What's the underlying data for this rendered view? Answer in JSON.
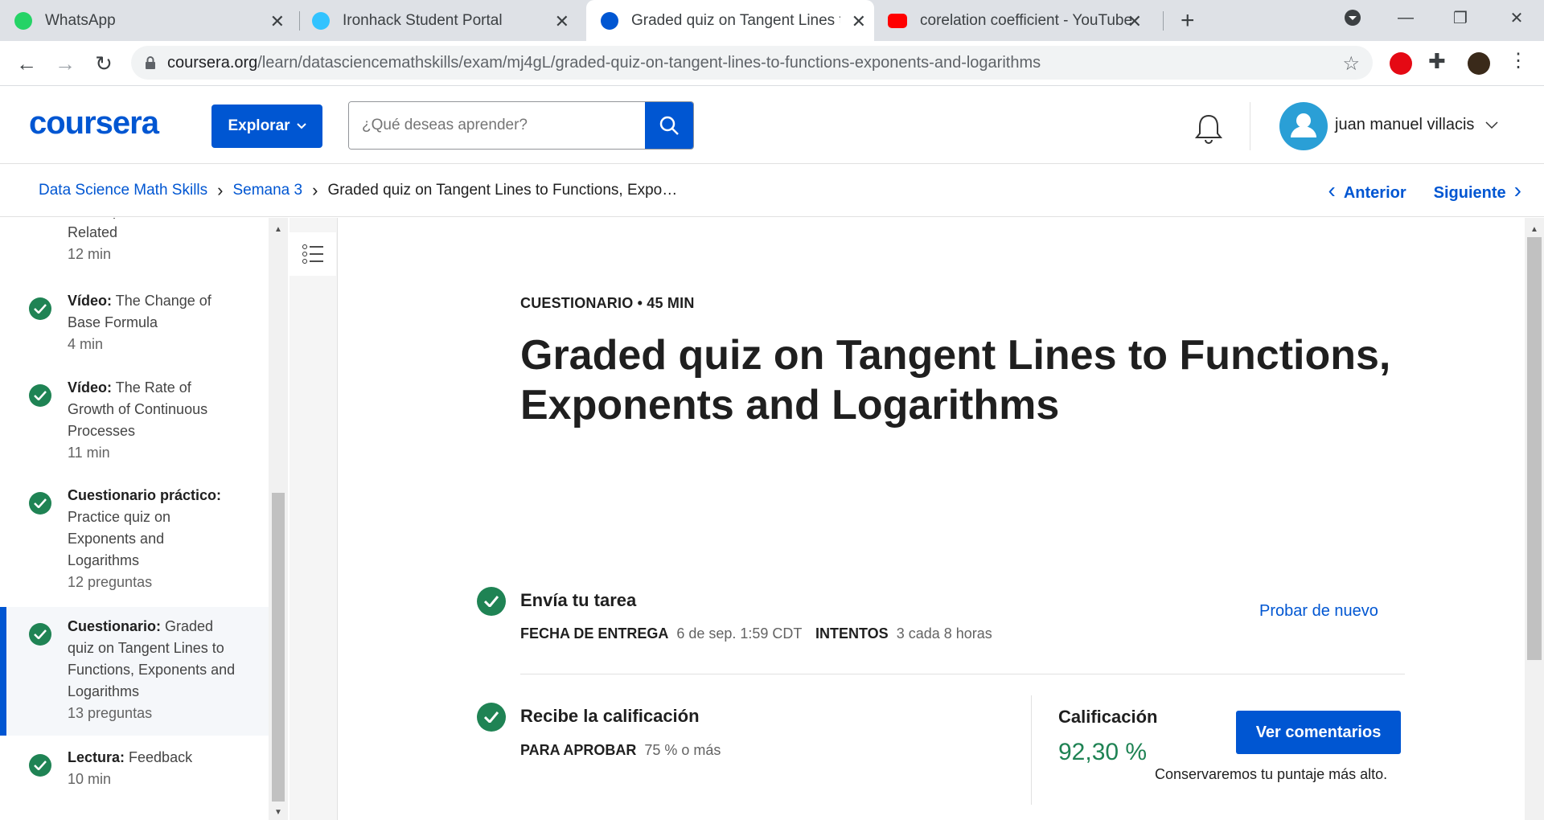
{
  "browser": {
    "tabs": [
      {
        "title": "WhatsApp",
        "icon": "whatsapp-icon",
        "color": "#25d366"
      },
      {
        "title": "Ironhack Student Portal",
        "icon": "ironhack-icon",
        "color": "#32c3ff"
      },
      {
        "title": "Graded quiz on Tangent Lines to",
        "icon": "coursera-icon",
        "color": "#0056d2"
      },
      {
        "title": "corelation coefficient - YouTube",
        "icon": "youtube-icon",
        "color": "#ff0000"
      }
    ],
    "url_host": "coursera.org",
    "url_path": "/learn/datasciencemathskills/exam/mj4gL/graded-quiz-on-tangent-lines-to-functions-exponents-and-logarithms"
  },
  "header": {
    "logo": "coursera",
    "explore_label": "Explorar",
    "search_placeholder": "¿Qué deseas aprender?",
    "user_name": "juan manuel villacis"
  },
  "breadcrumb": {
    "course": "Data Science Math Skills",
    "week": "Semana 3",
    "current": "Graded quiz on Tangent Lines to Functions, Expo…",
    "prev_label": "Anterior",
    "next_label": "Siguiente"
  },
  "sidebar": {
    "items": [
      {
        "type": "",
        "title": "and Exponents are Related",
        "duration": "12 min"
      },
      {
        "type": "Vídeo:",
        "title": "The Change of Base Formula",
        "duration": "4 min"
      },
      {
        "type": "Vídeo:",
        "title": "The Rate of Growth of Continuous Processes",
        "duration": "11 min"
      },
      {
        "type": "Cuestionario práctico:",
        "title": "Practice quiz on Exponents and Logarithms",
        "duration": "12 preguntas"
      },
      {
        "type": "Cuestionario:",
        "title": "Graded quiz on Tangent Lines to Functions, Exponents and Logarithms",
        "duration": "13 preguntas"
      },
      {
        "type": "Lectura:",
        "title": "Feedback",
        "duration": "10 min"
      }
    ]
  },
  "main": {
    "kicker": "CUESTIONARIO • 45 MIN",
    "title": "Graded quiz on Tangent Lines to Functions, Exponents and Logarithms",
    "submit": {
      "title": "Envía tu tarea",
      "due_label": "FECHA DE ENTREGA",
      "due_value": "6 de sep. 1:59 CDT",
      "attempts_label": "INTENTOS",
      "attempts_value": "3 cada 8 horas",
      "retry_label": "Probar de nuevo"
    },
    "grade": {
      "title": "Recibe la calificación",
      "pass_label": "PARA APROBAR",
      "pass_value": "75 % o más",
      "grade_label": "Calificación",
      "grade_value": "92,30 %",
      "comments_label": "Ver comentarios",
      "keep_note": "Conservaremos tu puntaje más alto."
    }
  },
  "colors": {
    "brand": "#0056d2",
    "success": "#1f8354"
  }
}
